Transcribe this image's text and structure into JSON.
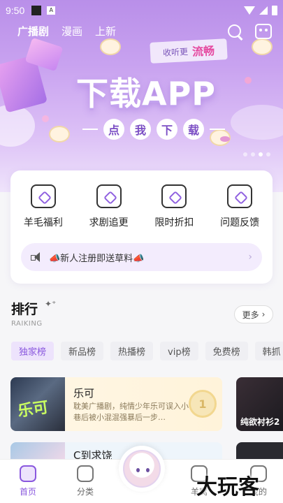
{
  "status_bar": {
    "time": "9:50",
    "notif_icon": "A"
  },
  "top_tabs": [
    {
      "label": "广播剧",
      "active": true
    },
    {
      "label": "漫画",
      "active": false
    },
    {
      "label": "上新",
      "active": false
    }
  ],
  "banner": {
    "tag_small": "收听更",
    "tag_big": "流畅",
    "title": "下载APP",
    "cta_chars": [
      "点",
      "我",
      "下",
      "载"
    ],
    "indicator_count": 4,
    "active_indicator": 2
  },
  "quick_access": [
    {
      "label": "羊毛福利",
      "icon": "sheep-gift-icon"
    },
    {
      "label": "求剧追更",
      "icon": "radio-icon"
    },
    {
      "label": "限时折扣",
      "icon": "discount-bag-icon"
    },
    {
      "label": "问题反馈",
      "icon": "feedback-icon"
    }
  ],
  "notice": {
    "text": "📣新人注册即送草料📣"
  },
  "ranking": {
    "title": "排行",
    "subtitle": "RAIKING",
    "more_label": "更多",
    "chips": [
      {
        "label": "独家榜",
        "active": true
      },
      {
        "label": "新品榜",
        "active": false
      },
      {
        "label": "热播榜",
        "active": false
      },
      {
        "label": "vip榜",
        "active": false
      },
      {
        "label": "免费榜",
        "active": false
      },
      {
        "label": "韩抓",
        "active": false
      }
    ],
    "items": [
      {
        "title": "乐可",
        "desc": "耽美广播剧，纯情少年乐可误入小巷后被小混混强暴后一步…",
        "cover_text": "乐可",
        "rank": "1"
      },
      {
        "title": "C到求饶",
        "desc": "",
        "cover_text": "",
        "rank": ""
      }
    ],
    "side_items": [
      {
        "cover_text": "纯欲衬衫2"
      }
    ]
  },
  "bottom_nav": [
    {
      "label": "首页",
      "active": true
    },
    {
      "label": "分类",
      "active": false
    },
    {
      "label": "羊窝",
      "active": false
    },
    {
      "label": "我的",
      "active": false
    }
  ],
  "watermark": "大玩客"
}
